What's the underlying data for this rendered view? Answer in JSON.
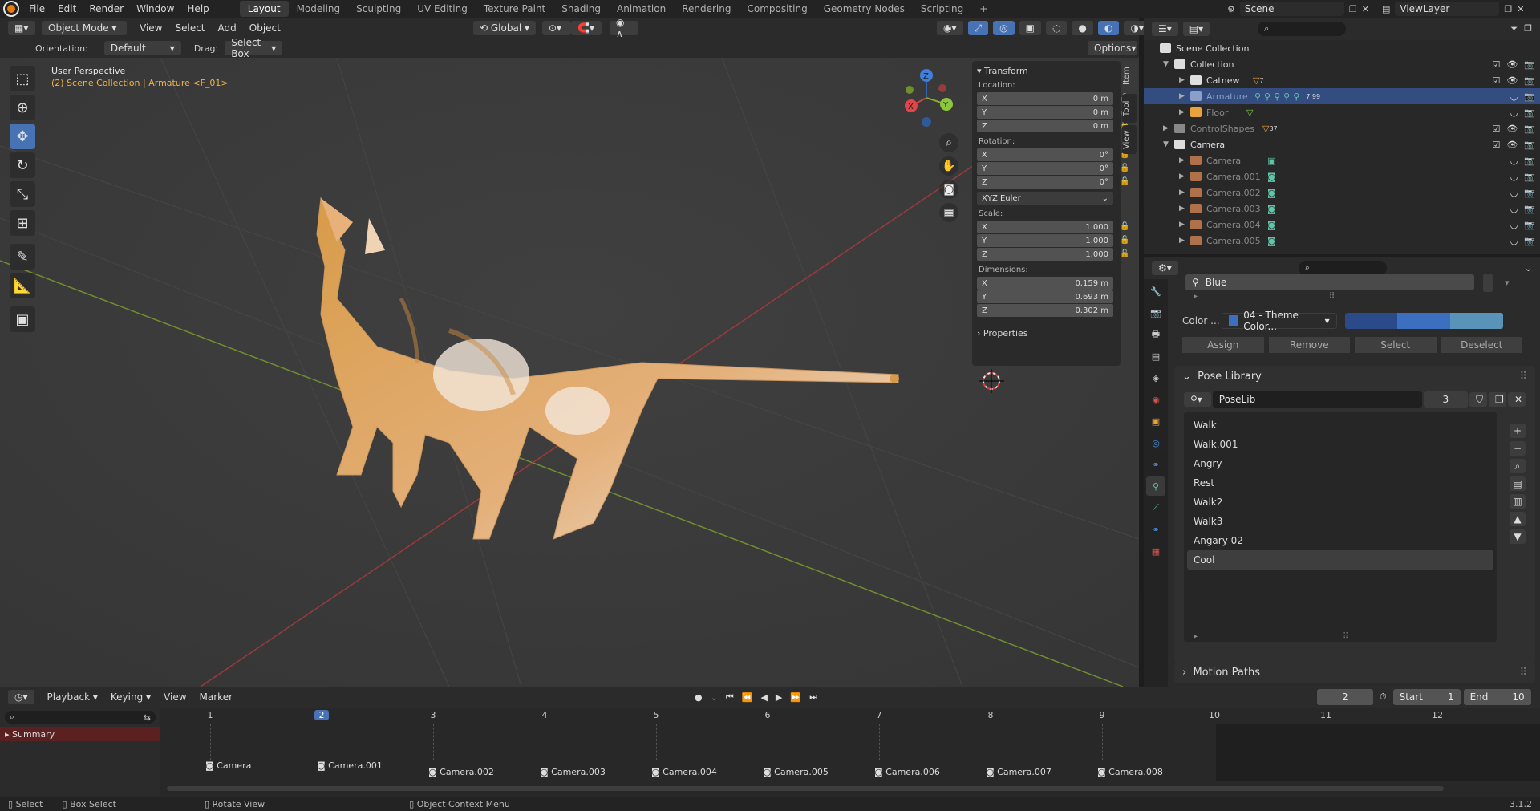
{
  "topbar": {
    "menus": [
      "File",
      "Edit",
      "Render",
      "Window",
      "Help"
    ],
    "workspaces": [
      "Layout",
      "Modeling",
      "Sculpting",
      "UV Editing",
      "Texture Paint",
      "Shading",
      "Animation",
      "Rendering",
      "Compositing",
      "Geometry Nodes",
      "Scripting"
    ],
    "active_workspace": "Layout",
    "add_tab": "+",
    "scene": "Scene",
    "view_layer": "ViewLayer"
  },
  "viewport_header": {
    "mode": "Object Mode",
    "menus": [
      "View",
      "Select",
      "Add",
      "Object"
    ],
    "transform_orientation": "Global",
    "orientation_label": "Orientation:",
    "orientation_value": "Default",
    "drag_label": "Drag:",
    "drag_value": "Select Box",
    "options": "Options"
  },
  "viewport": {
    "perspective": "User Perspective",
    "context": "(2) Scene Collection | Armature <F_01>",
    "gizmo_axes": [
      "X",
      "Y",
      "Z"
    ]
  },
  "npanel": {
    "transform_title": "Transform",
    "location_label": "Location:",
    "location": [
      {
        "axis": "X",
        "value": "0 m"
      },
      {
        "axis": "Y",
        "value": "0 m"
      },
      {
        "axis": "Z",
        "value": "0 m"
      }
    ],
    "rotation_label": "Rotation:",
    "rotation": [
      {
        "axis": "X",
        "value": "0°"
      },
      {
        "axis": "Y",
        "value": "0°"
      },
      {
        "axis": "Z",
        "value": "0°"
      }
    ],
    "rotation_mode": "XYZ Euler",
    "scale_label": "Scale:",
    "scale": [
      {
        "axis": "X",
        "value": "1.000"
      },
      {
        "axis": "Y",
        "value": "1.000"
      },
      {
        "axis": "Z",
        "value": "1.000"
      }
    ],
    "dimensions_label": "Dimensions:",
    "dimensions": [
      {
        "axis": "X",
        "value": "0.159 m"
      },
      {
        "axis": "Y",
        "value": "0.693 m"
      },
      {
        "axis": "Z",
        "value": "0.302 m"
      }
    ],
    "properties_title": "Properties",
    "tabs": [
      "Item",
      "Tool",
      "View"
    ]
  },
  "outliner": {
    "root": "Scene Collection",
    "rows": [
      {
        "name": "Collection",
        "indent": 1,
        "color": "#cccccc"
      },
      {
        "name": "Catnew",
        "indent": 2,
        "color": "#cccccc",
        "badge": "7"
      },
      {
        "name": "Armature",
        "indent": 2,
        "color": "#8a9fc9",
        "badge": "7 99"
      },
      {
        "name": "Floor",
        "indent": 2,
        "color": "#888888"
      },
      {
        "name": "ControlShapes",
        "indent": 1,
        "color": "#888888",
        "badge": "37"
      },
      {
        "name": "Camera",
        "indent": 1,
        "color": "#cccccc"
      },
      {
        "name": "Camera",
        "indent": 2,
        "color": "#888888"
      },
      {
        "name": "Camera.001",
        "indent": 2,
        "color": "#888888"
      },
      {
        "name": "Camera.002",
        "indent": 2,
        "color": "#888888"
      },
      {
        "name": "Camera.003",
        "indent": 2,
        "color": "#888888"
      },
      {
        "name": "Camera.004",
        "indent": 2,
        "color": "#888888"
      },
      {
        "name": "Camera.005",
        "indent": 2,
        "color": "#888888"
      }
    ]
  },
  "properties": {
    "bone_group": "Blue",
    "color_label": "Color ...",
    "color_set": "04 - Theme Color...",
    "buttons": [
      "Assign",
      "Remove",
      "Select",
      "Deselect"
    ],
    "pose_library_title": "Pose Library",
    "poselib_name": "PoseLib",
    "poselib_users": "3",
    "poses": [
      "Walk",
      "Walk.001",
      "Angry",
      "Rest",
      "Walk2",
      "Walk3",
      "Angary 02",
      "Cool"
    ],
    "selected_pose": "Cool",
    "motion_paths_title": "Motion Paths",
    "colors": {
      "swatch1": "#2b4a8a",
      "swatch2": "#3d6fc0",
      "swatch3": "#5a93b8"
    }
  },
  "timeline": {
    "menus": [
      "Playback",
      "Keying",
      "View",
      "Marker"
    ],
    "current_frame": "2",
    "start_label": "Start",
    "start": "1",
    "end_label": "End",
    "end": "10",
    "summary": "Summary",
    "frames": [
      "1",
      "2",
      "3",
      "4",
      "5",
      "6",
      "7",
      "8",
      "9",
      "10",
      "11",
      "12"
    ],
    "markers": [
      "Camera",
      "Camera.001",
      "Camera.002",
      "Camera.003",
      "Camera.004",
      "Camera.005",
      "Camera.006",
      "Camera.007",
      "Camera.008"
    ]
  },
  "statusbar": {
    "items": [
      "Select",
      "Box Select",
      "Rotate View",
      "Object Context Menu"
    ],
    "version": "3.1.2"
  }
}
